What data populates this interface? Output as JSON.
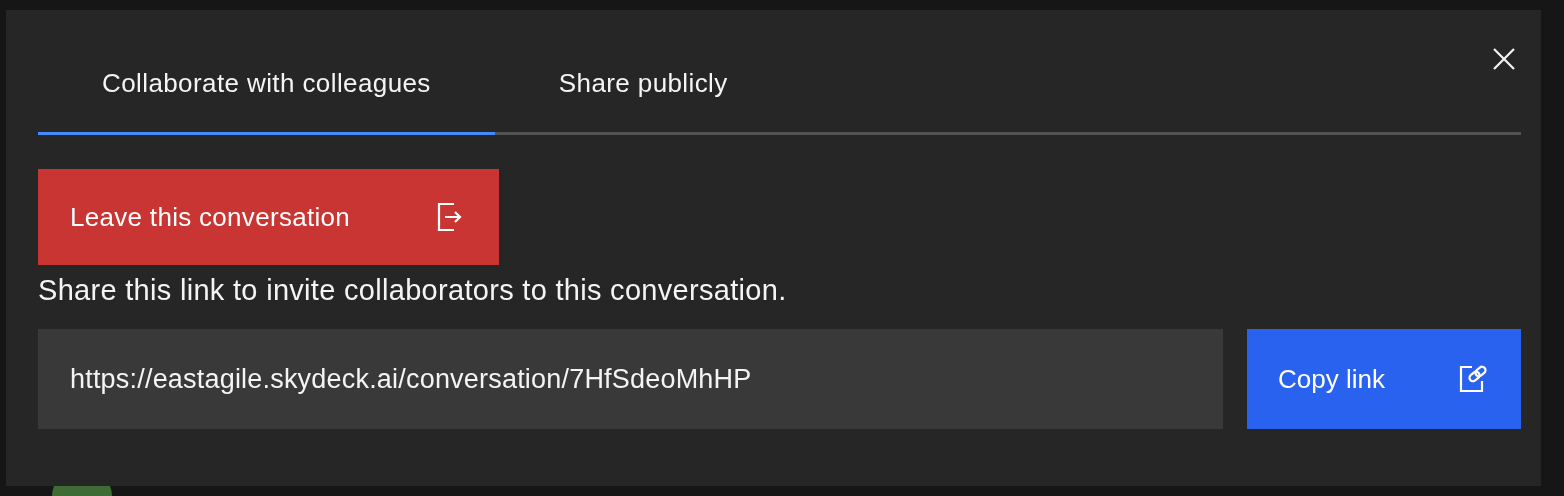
{
  "background": {
    "avatar": {
      "kind": "avatar"
    }
  },
  "dialog": {
    "tabs": [
      {
        "label": "Collaborate with colleagues",
        "selected": true
      },
      {
        "label": "Share publicly",
        "selected": false
      }
    ],
    "leave_button": "Leave this conversation",
    "instruction": "Share this link to invite collaborators to this conversation.",
    "link_field": {
      "value": "https://eastagile.skydeck.ai/conversation/7HfSdeoMhHP"
    },
    "copy_button": "Copy link"
  }
}
